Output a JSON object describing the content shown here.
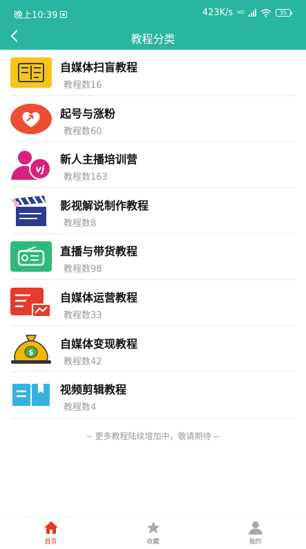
{
  "status_bar": {
    "time": "晚上10:39",
    "net_speed": "423K/s",
    "network_type": "HD",
    "battery": "35"
  },
  "nav": {
    "title": "教程分类"
  },
  "categories": [
    {
      "title": "自媒体扫盲教程",
      "count_label": "教程数16",
      "icon": "article-icon"
    },
    {
      "title": "起号与涨粉",
      "count_label": "教程数60",
      "icon": "heart-arrow-icon"
    },
    {
      "title": "新人主播培训营",
      "count_label": "教程数163",
      "icon": "streamer-icon"
    },
    {
      "title": "影视解说制作教程",
      "count_label": "教程数8",
      "icon": "clapperboard-icon"
    },
    {
      "title": "直播与带货教程",
      "count_label": "教程数98",
      "icon": "radio-icon"
    },
    {
      "title": "自媒体运营教程",
      "count_label": "教程数33",
      "icon": "chart-doc-icon"
    },
    {
      "title": "自媒体变现教程",
      "count_label": "教程数42",
      "icon": "money-bag-icon"
    },
    {
      "title": "视频剪辑教程",
      "count_label": "教程数4",
      "icon": "book-icon"
    }
  ],
  "footer_note": "-- 更多教程陆续增加中，敬请期待 --",
  "tabbar": [
    {
      "label": "首页",
      "icon": "home-icon",
      "active": true
    },
    {
      "label": "收藏",
      "icon": "star-icon",
      "active": false
    },
    {
      "label": "我的",
      "icon": "user-icon",
      "active": false
    }
  ],
  "colors": {
    "header": "#2ab59e",
    "active_tab": "#e53a20",
    "muted_text": "#999999"
  }
}
